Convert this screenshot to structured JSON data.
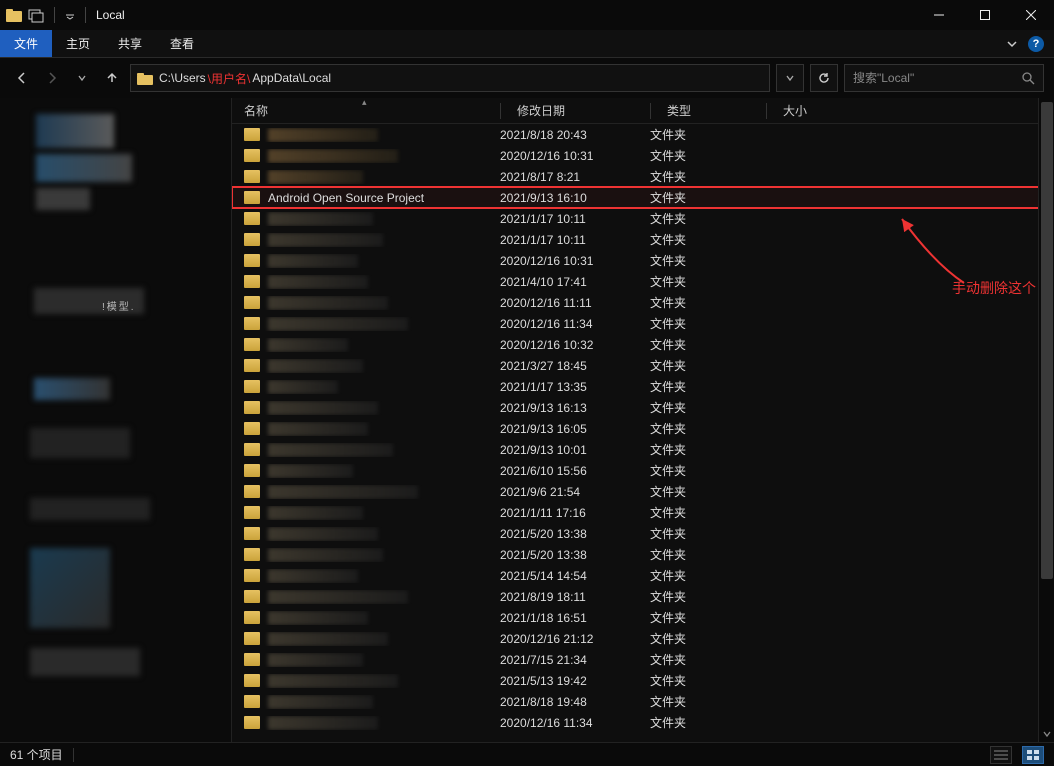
{
  "window": {
    "title": "Local"
  },
  "ribbon": {
    "file": "文件",
    "home": "主页",
    "share": "共享",
    "view": "查看"
  },
  "address": {
    "prefix": "C:\\Users",
    "user_token": "\\用户名\\",
    "suffix": "AppData\\Local"
  },
  "search": {
    "placeholder": "搜索\"Local\""
  },
  "columns": {
    "name": "名称",
    "date": "修改日期",
    "type": "类型",
    "size": "大小"
  },
  "type_folder": "文件夹",
  "highlighted_name": "Android Open Source Project",
  "annotation": "手动删除这个",
  "rows": [
    {
      "date": "2021/8/18 20:43",
      "blur": "warm",
      "w": 110
    },
    {
      "date": "2020/12/16 10:31",
      "blur": "warm",
      "w": 130
    },
    {
      "date": "2021/8/17 8:21",
      "blur": "warm",
      "w": 95
    },
    {
      "date": "2021/9/13 16:10",
      "name": "Android Open Source Project",
      "highlight": true
    },
    {
      "date": "2021/1/17 10:11",
      "blur": "cool",
      "w": 105
    },
    {
      "date": "2021/1/17 10:11",
      "blur": "cool",
      "w": 115
    },
    {
      "date": "2020/12/16 10:31",
      "blur": "cool",
      "w": 90
    },
    {
      "date": "2021/4/10 17:41",
      "blur": "cool",
      "w": 100
    },
    {
      "date": "2020/12/16 11:11",
      "blur": "cool",
      "w": 120
    },
    {
      "date": "2020/12/16 11:34",
      "blur": "cool",
      "w": 140
    },
    {
      "date": "2020/12/16 10:32",
      "blur": "cool",
      "w": 80
    },
    {
      "date": "2021/3/27 18:45",
      "blur": "cool",
      "w": 95
    },
    {
      "date": "2021/1/17 13:35",
      "blur": "cool",
      "w": 70
    },
    {
      "date": "2021/9/13 16:13",
      "blur": "cool",
      "w": 110
    },
    {
      "date": "2021/9/13 16:05",
      "blur": "cool",
      "w": 100
    },
    {
      "date": "2021/9/13 10:01",
      "blur": "cool",
      "w": 125
    },
    {
      "date": "2021/6/10 15:56",
      "blur": "cool",
      "w": 85
    },
    {
      "date": "2021/9/6 21:54",
      "blur": "cool",
      "w": 150
    },
    {
      "date": "2021/1/11 17:16",
      "blur": "cool",
      "w": 95
    },
    {
      "date": "2021/5/20 13:38",
      "blur": "cool",
      "w": 110
    },
    {
      "date": "2021/5/20 13:38",
      "blur": "cool",
      "w": 115
    },
    {
      "date": "2021/5/14 14:54",
      "blur": "cool",
      "w": 90
    },
    {
      "date": "2021/8/19 18:11",
      "blur": "cool",
      "w": 140
    },
    {
      "date": "2021/1/18 16:51",
      "blur": "cool",
      "w": 100
    },
    {
      "date": "2020/12/16 21:12",
      "blur": "cool",
      "w": 120
    },
    {
      "date": "2021/7/15 21:34",
      "blur": "cool",
      "w": 95
    },
    {
      "date": "2021/5/13 19:42",
      "blur": "cool",
      "w": 130
    },
    {
      "date": "2021/8/18 19:48",
      "blur": "cool",
      "w": 105
    },
    {
      "date": "2020/12/16 11:34",
      "blur": "cool",
      "w": 110
    }
  ],
  "status": {
    "count_label": "61 个项目"
  }
}
